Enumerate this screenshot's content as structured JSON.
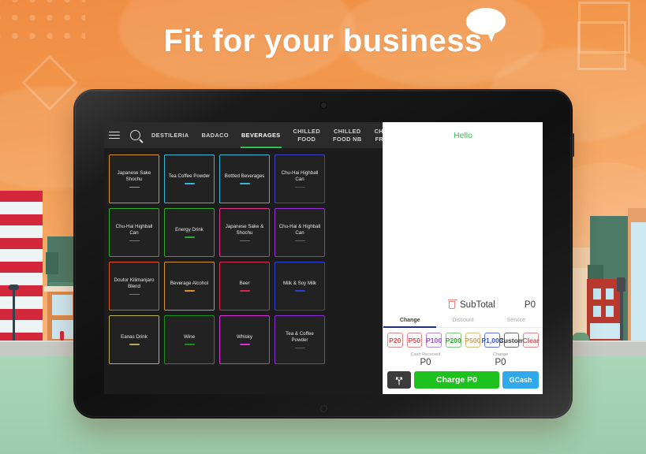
{
  "banner": {
    "headline": "Fit for your business",
    "bubble_icon": "speech-bubble-icon"
  },
  "pos": {
    "topbar": {
      "menu_icon": "hamburger-menu-icon",
      "search_icon": "search-icon",
      "tabs": [
        {
          "label": "DESTILERIA",
          "active": false
        },
        {
          "label": "BADACO",
          "active": false
        },
        {
          "label": "BEVERAGES",
          "active": true
        },
        {
          "label": "CHILLED\nFOOD",
          "active": false
        },
        {
          "label": "CHILLED\nFOOD NB",
          "active": false
        },
        {
          "label": "CHILLED\nFROZEN",
          "active": false
        }
      ],
      "active_underline_color": "#2ec14e"
    },
    "catalog": {
      "tiles": [
        {
          "name": "Japanese Sake Shochu",
          "border": "#d8912f",
          "bar": "#d8912f"
        },
        {
          "name": "Tea  Coffee Powder",
          "border": "#3bb4d8",
          "bar": "#3bb4d8"
        },
        {
          "name": "Bottled Beverages",
          "border": "#3bb4d8",
          "bar": "#3bb4d8"
        },
        {
          "name": "Chu-Hai Highball Can",
          "border": "#4242c8",
          "bar": "#4242c8"
        },
        {
          "name": "Chu-Hai Highball Can",
          "border": "#2faa2f",
          "bar": "#2faa2f"
        },
        {
          "name": "Energy Drink",
          "border": "#2faa2f",
          "bar": "#2faa2f"
        },
        {
          "name": "Japanese Sake & Shochu",
          "border": "#e0358a",
          "bar": "#e0358a"
        },
        {
          "name": "Chu-Hai & Highball Can",
          "border": "#9b30d9",
          "bar": "#9b30d9"
        },
        {
          "name": "Doutor Kilimanjaro Blend",
          "border": "#e2561e",
          "bar": "#e2561e"
        },
        {
          "name": "Beverage Alcohol",
          "border": "#d8912f",
          "bar": "#d8912f"
        },
        {
          "name": "Beer",
          "border": "#d62a52",
          "bar": "#d62a52"
        },
        {
          "name": "Milk & Soy Milk",
          "border": "#2a3fd6",
          "bar": "#2a3fd6"
        },
        {
          "name": "Eanas Drink",
          "border": "#b6ae5e",
          "bar": "#b6ae5e"
        },
        {
          "name": "Wine",
          "border": "#1c8f1c",
          "bar": "#1c8f1c"
        },
        {
          "name": "Whisky",
          "border": "#d92fd9",
          "bar": "#d92fd9"
        },
        {
          "name": "Tea & Coffee Powder",
          "border": "#8b2fd9",
          "bar": "#8b2fd9"
        }
      ]
    },
    "cart": {
      "greeting": "Hello",
      "greeting_color": "#2ec14e",
      "delete_icon": "trash-icon",
      "subtotal_label": "SubTotal",
      "subtotal_value": "P0",
      "tabs": [
        {
          "label": "Change",
          "active": true
        },
        {
          "label": "Discount",
          "active": false
        },
        {
          "label": "Service",
          "active": false
        }
      ],
      "active_tab_underline_color": "#20307a",
      "denominations": [
        {
          "label": "P20",
          "color": "#d94f4f",
          "border": "#dd8a8a"
        },
        {
          "label": "P50",
          "color": "#d94f4f",
          "border": "#dd8a8a"
        },
        {
          "label": "P100",
          "color": "#9b4fd9",
          "border": "#b88ae0"
        },
        {
          "label": "P200",
          "color": "#2faa2f",
          "border": "#7cc97c"
        },
        {
          "label": "P500",
          "color": "#c9a44f",
          "border": "#d7bb7e"
        },
        {
          "label": "P1,000",
          "color": "#3a55d9",
          "border": "#5b73df"
        },
        {
          "label": "Custom",
          "color": "#3c3c3c",
          "border": "#6a6a6a"
        },
        {
          "label": "Clear",
          "color": "#d94f4f",
          "border": "#dd8a8a"
        }
      ],
      "cash_received_label": "Cash Received",
      "cash_received_value": "P0",
      "change_label": "Change",
      "change_value": "P0",
      "split_icon": "split-payment-icon",
      "charge_label": "Charge P0",
      "charge_color": "#1ec21e",
      "gcash_label": "GCash",
      "gcash_color": "#2fa8ec"
    }
  }
}
